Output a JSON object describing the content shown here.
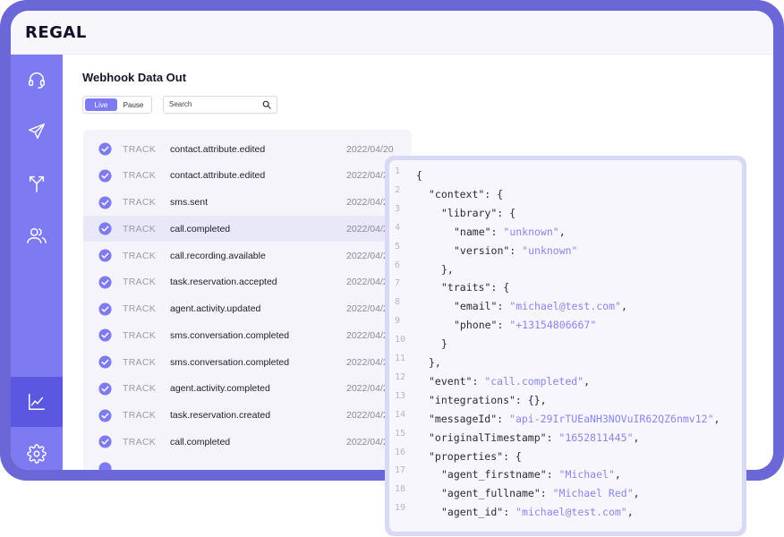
{
  "app": {
    "logo": "REGAL"
  },
  "sidebar": {
    "items": [
      {
        "icon": "headset-icon",
        "active": false
      },
      {
        "icon": "send-icon",
        "active": false
      },
      {
        "icon": "branch-arrows-icon",
        "active": false
      },
      {
        "icon": "users-icon",
        "active": false
      },
      {
        "icon": "analytics-chart-icon",
        "active": true
      },
      {
        "icon": "settings-gear-icon",
        "active": false
      }
    ]
  },
  "page": {
    "title": "Webhook Data Out",
    "toggle": {
      "live": "Live",
      "pause": "Pause"
    },
    "search": {
      "placeholder": "Search"
    }
  },
  "events": [
    {
      "type": "TRACK",
      "name": "contact.attribute.edited",
      "date": "2022/04/20"
    },
    {
      "type": "TRACK",
      "name": "contact.attribute.edited",
      "date": "2022/04/20"
    },
    {
      "type": "TRACK",
      "name": "sms.sent",
      "date": "2022/04/20"
    },
    {
      "type": "TRACK",
      "name": "call.completed",
      "date": "2022/04/20",
      "selected": true
    },
    {
      "type": "TRACK",
      "name": "call.recording.available",
      "date": "2022/04/20"
    },
    {
      "type": "TRACK",
      "name": "task.reservation.accepted",
      "date": "2022/04/20"
    },
    {
      "type": "TRACK",
      "name": "agent.activity.updated",
      "date": "2022/04/20"
    },
    {
      "type": "TRACK",
      "name": "sms.conversation.completed",
      "date": "2022/04/20"
    },
    {
      "type": "TRACK",
      "name": "sms.conversation.completed",
      "date": "2022/04/20"
    },
    {
      "type": "TRACK",
      "name": "agent.activity.completed",
      "date": "2022/04/20"
    },
    {
      "type": "TRACK",
      "name": "task.reservation.created",
      "date": "2022/04/20"
    },
    {
      "type": "TRACK",
      "name": "call.completed",
      "date": "2022/04/20"
    }
  ],
  "code": {
    "lines": [
      {
        "n": "1",
        "indent": 0,
        "parts": [
          [
            "p",
            "{"
          ]
        ]
      },
      {
        "n": "2",
        "indent": 1,
        "parts": [
          [
            "p",
            "\"context\": {"
          ]
        ]
      },
      {
        "n": "3",
        "indent": 2,
        "parts": [
          [
            "p",
            "\"library\": {"
          ]
        ]
      },
      {
        "n": "4",
        "indent": 3,
        "parts": [
          [
            "p",
            "\"name\": "
          ],
          [
            "s",
            "\"unknown\""
          ],
          [
            "p",
            ","
          ]
        ]
      },
      {
        "n": "5",
        "indent": 3,
        "parts": [
          [
            "p",
            "\"version\": "
          ],
          [
            "s",
            "\"unknown\""
          ]
        ]
      },
      {
        "n": "6",
        "indent": 2,
        "parts": [
          [
            "p",
            "},"
          ]
        ]
      },
      {
        "n": "7",
        "indent": 2,
        "parts": [
          [
            "p",
            "\"traits\": {"
          ]
        ]
      },
      {
        "n": "8",
        "indent": 3,
        "parts": [
          [
            "p",
            "\"email\": "
          ],
          [
            "s",
            "\"michael@test.com\""
          ],
          [
            "p",
            ","
          ]
        ]
      },
      {
        "n": "9",
        "indent": 3,
        "parts": [
          [
            "p",
            "\"phone\": "
          ],
          [
            "s",
            "\"+13154806667\""
          ]
        ]
      },
      {
        "n": "10",
        "indent": 2,
        "parts": [
          [
            "p",
            "}"
          ]
        ]
      },
      {
        "n": "11",
        "indent": 1,
        "parts": [
          [
            "p",
            "},"
          ]
        ]
      },
      {
        "n": "12",
        "indent": 1,
        "parts": [
          [
            "p",
            "\"event\": "
          ],
          [
            "s",
            "\"call.completed\""
          ],
          [
            "p",
            ","
          ]
        ]
      },
      {
        "n": "13",
        "indent": 1,
        "parts": [
          [
            "p",
            "\"integrations\": {},"
          ]
        ]
      },
      {
        "n": "14",
        "indent": 1,
        "parts": [
          [
            "p",
            "\"messageId\": "
          ],
          [
            "s",
            "\"api-29IrTUEaNH3NOVuIR62QZ6nmv12\""
          ],
          [
            "p",
            ","
          ]
        ]
      },
      {
        "n": "15",
        "indent": 1,
        "parts": [
          [
            "p",
            "\"originalTimestamp\": "
          ],
          [
            "s",
            "\"1652811445\""
          ],
          [
            "p",
            ","
          ]
        ]
      },
      {
        "n": "16",
        "indent": 1,
        "parts": [
          [
            "p",
            "\"properties\": {"
          ]
        ]
      },
      {
        "n": "17",
        "indent": 2,
        "parts": [
          [
            "p",
            "\"agent_firstname\": "
          ],
          [
            "s",
            "\"Michael\""
          ],
          [
            "p",
            ","
          ]
        ]
      },
      {
        "n": "18",
        "indent": 2,
        "parts": [
          [
            "p",
            "\"agent_fullname\": "
          ],
          [
            "s",
            "\"Michael Red\""
          ],
          [
            "p",
            ","
          ]
        ]
      },
      {
        "n": "19",
        "indent": 2,
        "parts": [
          [
            "p",
            "\"agent_id\": "
          ],
          [
            "s",
            "\"michael@test.com\""
          ],
          [
            "p",
            ","
          ]
        ]
      }
    ]
  },
  "colors": {
    "frame": "#6b67d6",
    "sidebar": "#7d7af2",
    "accent": "#7d7af2",
    "string": "#8a86ec"
  }
}
